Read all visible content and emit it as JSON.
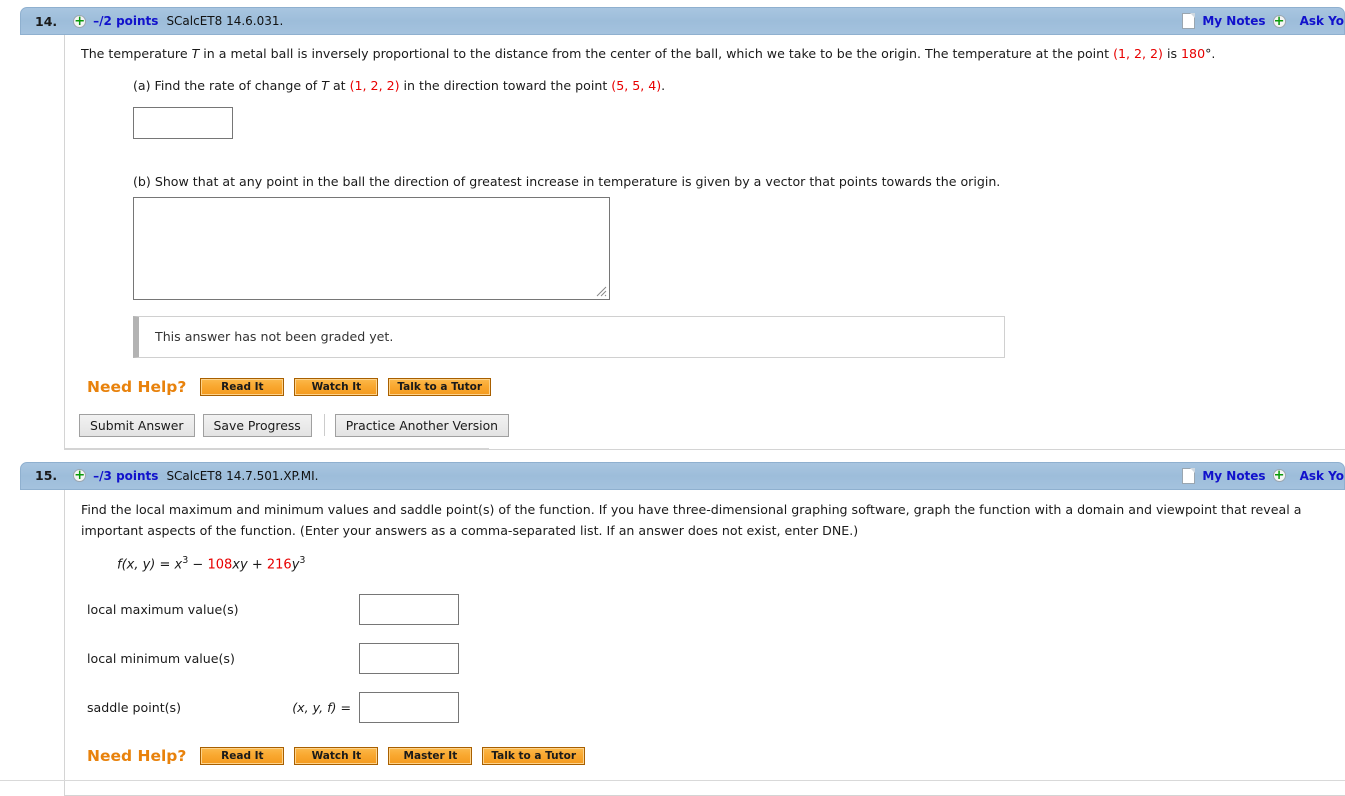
{
  "questions": [
    {
      "number": "14.",
      "points": "–/2 points",
      "code": "SCalcET8 14.6.031.",
      "my_notes_label": "My Notes",
      "ask_teacher_label": "Ask Yo",
      "note_icon": "note-icon",
      "plus_icon": "plus-icon",
      "prompt": {
        "seg1": "The temperature ",
        "seg2_italic": "T",
        "seg3": " in a metal ball is inversely proportional to the distance from the center of the ball, which we take to be the origin. The temperature at the point ",
        "point_a": "(1, 2, 2)",
        "seg4": " is ",
        "temp": "180",
        "seg5": "°."
      },
      "part_a": {
        "seg1": "(a) Find the rate of change of ",
        "italic_t": "T",
        "seg2": " at ",
        "point1": "(1, 2, 2)",
        "seg3": " in the direction toward the point ",
        "point2": "(5, 5, 4)",
        "seg4": ".",
        "input_value": ""
      },
      "part_b": {
        "text": "(b) Show that at any point in the ball the direction of greatest increase in temperature is given by a vector that points towards the origin.",
        "textarea_value": ""
      },
      "graded_message": "This answer has not been graded yet.",
      "need_help": {
        "label": "Need Help?",
        "buttons": [
          "Read It",
          "Watch It",
          "Talk to a Tutor"
        ]
      },
      "actions": {
        "submit": "Submit Answer",
        "save": "Save Progress",
        "practice": "Practice Another Version"
      }
    },
    {
      "number": "15.",
      "points": "–/3 points",
      "code": "SCalcET8 14.7.501.XP.MI.",
      "my_notes_label": "My Notes",
      "ask_teacher_label": "Ask Yo",
      "prompt_line1": "Find the local maximum and minimum values and saddle point(s) of the function. If you have three-dimensional graphing software, graph the function with a domain and viewpoint that reveal a",
      "prompt_line2": "important aspects of the function. (Enter your answers as a comma-separated list. If an answer does not exist, enter DNE.)",
      "formula": {
        "fn": "f(x, y)",
        "eq": " = ",
        "term1_base": "x",
        "term1_exp": "3",
        "minus": " − ",
        "coef1": "108",
        "var1": "xy",
        "plus": " + ",
        "coef2": "216",
        "var2": "y",
        "term2_exp": "3"
      },
      "answers": [
        {
          "label": "local maximum value(s)",
          "prefix": "",
          "value": ""
        },
        {
          "label": "local minimum value(s)",
          "prefix": "",
          "value": ""
        },
        {
          "label": "saddle point(s)",
          "prefix": "(x, y, f)  =",
          "value": ""
        }
      ],
      "need_help": {
        "label": "Need Help?",
        "buttons": [
          "Read It",
          "Watch It",
          "Master It",
          "Talk to a Tutor"
        ]
      }
    }
  ],
  "colors": {
    "header_bar": "#a4c2de",
    "link_blue": "#1111cc",
    "accent_red": "#e80000",
    "need_help_orange": "#e8820c",
    "button_orange": "#f9a830"
  }
}
